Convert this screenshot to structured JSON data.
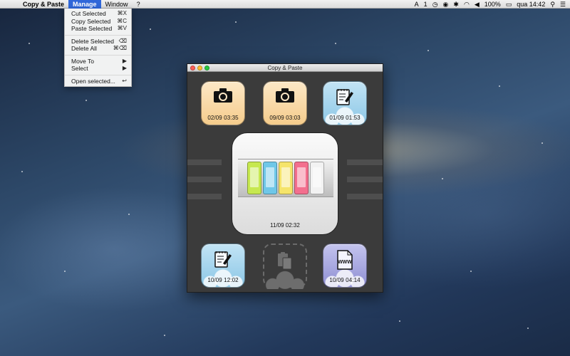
{
  "menubar": {
    "apple_icon": "apple-icon",
    "app_name": "Copy & Paste",
    "menus": [
      "Manage",
      "Window",
      "?"
    ],
    "active_menu": "Manage",
    "status": {
      "input_indicator": "A",
      "display_num": "1",
      "battery": "100%",
      "clock": "qua 14:42"
    }
  },
  "manage_menu": {
    "items": [
      {
        "label": "Cut Selected",
        "shortcut": "⌘X"
      },
      {
        "label": "Copy Selected",
        "shortcut": "⌘C"
      },
      {
        "label": "Paste Selected",
        "shortcut": "⌘V"
      },
      {
        "label": "Delete Selected",
        "shortcut": "⌫"
      },
      {
        "label": "Delete All",
        "shortcut": "⌘⌫"
      },
      {
        "label": "Move To",
        "shortcut": "▶"
      },
      {
        "label": "Select",
        "shortcut": "▶"
      },
      {
        "label": "Open selected...",
        "shortcut": "↩"
      }
    ]
  },
  "window": {
    "title": "Copy & Paste",
    "tiles": [
      {
        "type": "photo",
        "time": "02/09 03:35",
        "color": "#f5cc8c"
      },
      {
        "type": "photo",
        "time": "09/09 03:03",
        "color": "#f5cc8c"
      },
      {
        "type": "note",
        "time": "01/09 01:53",
        "color": "#8cc7e6"
      },
      {
        "type": "note",
        "time": "10/09 12:02",
        "color": "#8cc7e6"
      },
      {
        "type": "web",
        "time": "10/09 04:14",
        "color": "#8f8fd3",
        "badge": "WWW"
      }
    ],
    "featured": {
      "type": "image",
      "time": "11/09 02:32"
    }
  }
}
